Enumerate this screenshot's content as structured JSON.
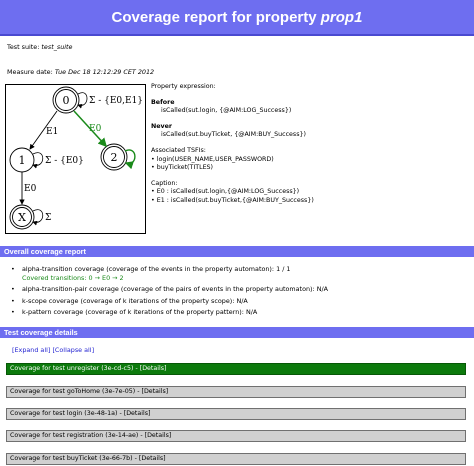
{
  "header": {
    "title_prefix": "Coverage report for property",
    "title_prop": "prop1"
  },
  "meta": {
    "suite_label": "Test suite:",
    "suite_value": "test_suite",
    "date_label": "Measure date:",
    "date_value": "Tue Dec 18 12:12:29 CET 2012"
  },
  "diagram": {
    "states": [
      "0",
      "1",
      "2",
      "X"
    ],
    "loops": [
      "Σ - {E0,E1}",
      "Σ - {E0}",
      "Σ"
    ],
    "edges": [
      "E1",
      "E0",
      "E0"
    ],
    "colors": {
      "covered": "#1a8a1a",
      "default": "#000000"
    }
  },
  "property": {
    "expression_label": "Property expression:",
    "before_label": "Before",
    "before_value": "isCalled(sut.login, {@AIM:LOG_Success})",
    "never_label": "Never",
    "never_value": "isCalled(sut.buyTicket, {@AIM:BUY_Success})",
    "tsfi_label": "Associated TSFIs:",
    "tsfi_1": "• login(USER_NAME,USER_PASSWORD)",
    "tsfi_2": "• buyTicket(TITLES)",
    "caption_label": "Caption:",
    "caption_1": "• E0 : isCalled(sut.login,{@AIM:LOG_Success})",
    "caption_2": "• E1 : isCalled(sut.buyTicket,{@AIM:BUY_Success})"
  },
  "overall": {
    "title": "Overall coverage report",
    "alpha": "alpha-transition coverage (coverage of the events in the property automaton): 1 / 1",
    "covered": "Covered transitions: 0 → E0 → 2",
    "alpha_pair": "alpha-transition-pair coverage (coverage of the pairs of events in the property automaton): N/A",
    "kscope": "k-scope coverage (coverage of k iterations of the property scope): N/A",
    "kpattern": "k-pattern coverage (coverage of k iterations of the property pattern): N/A"
  },
  "details": {
    "title": "Test coverage details",
    "expand": "[Expand all]",
    "collapse": "[Collapse all]",
    "tests": [
      "Coverage for test unregister (3e-cd-c5) - [Details]",
      "Coverage for test goToHome (3e-7e-05) - [Details]",
      "Coverage for test login (3e-48-1a) - [Details]",
      "Coverage for test registration (3e-14-ae) - [Details]",
      "Coverage for test buyTicket (3e-66-7b) - [Details]"
    ],
    "active_color": "#0c7a0c"
  }
}
